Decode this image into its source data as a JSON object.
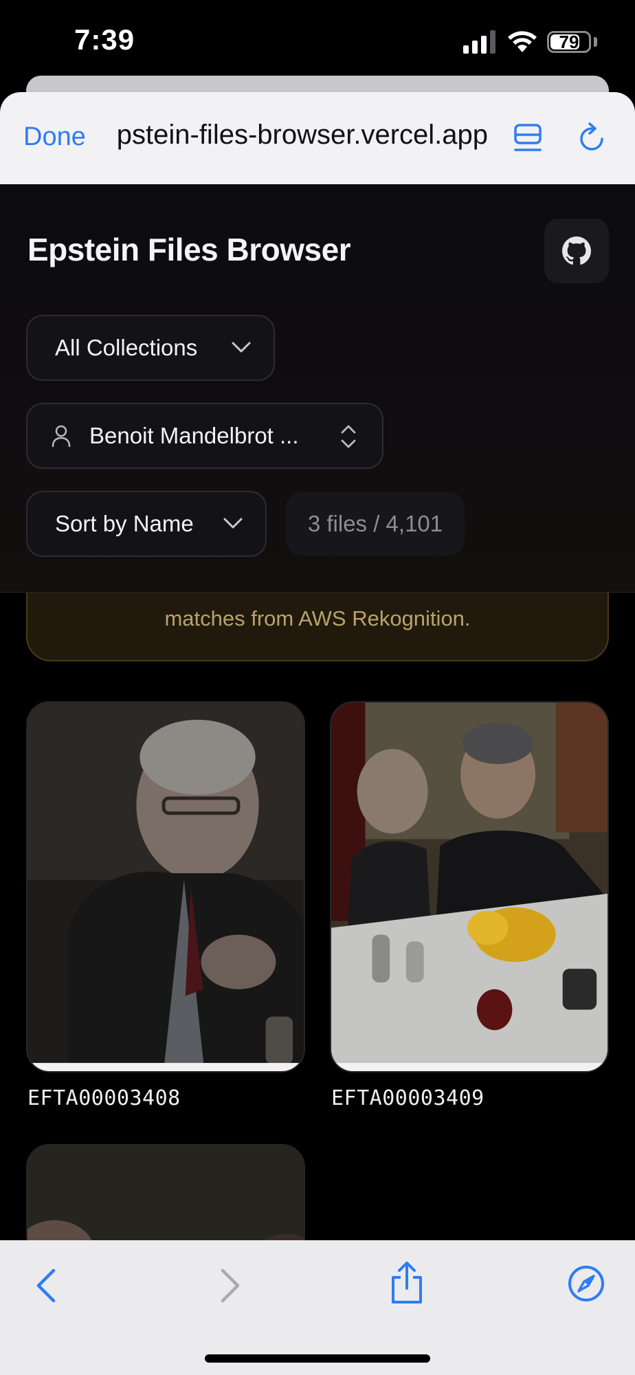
{
  "status_bar": {
    "time": "7:39",
    "battery_level": "79",
    "signal_icon": "cellular-signal-icon",
    "wifi_icon": "wifi-icon",
    "battery_icon": "battery-icon"
  },
  "browser": {
    "done_label": "Done",
    "url": "epstein-files-browser.vercel.app",
    "reader_icon": "reader-view-icon",
    "reload_icon": "reload-icon",
    "accent_color": "#2f7cf6"
  },
  "header": {
    "title": "Epstein Files Browser",
    "github_icon": "github-icon"
  },
  "filters": {
    "collection": "All Collections",
    "person": "Benoit Mandelbrot ...",
    "sort": "Sort by Name",
    "count": "3 files / 4,101"
  },
  "notice": {
    "text": "matches from AWS Rekognition."
  },
  "files": [
    {
      "name": "EFTA00003408"
    },
    {
      "name": "EFTA00003409"
    },
    {
      "name": ""
    }
  ],
  "toolbar": {
    "back_icon": "chevron-left-icon",
    "forward_icon": "chevron-right-icon",
    "share_icon": "share-icon",
    "compass_icon": "compass-icon"
  }
}
